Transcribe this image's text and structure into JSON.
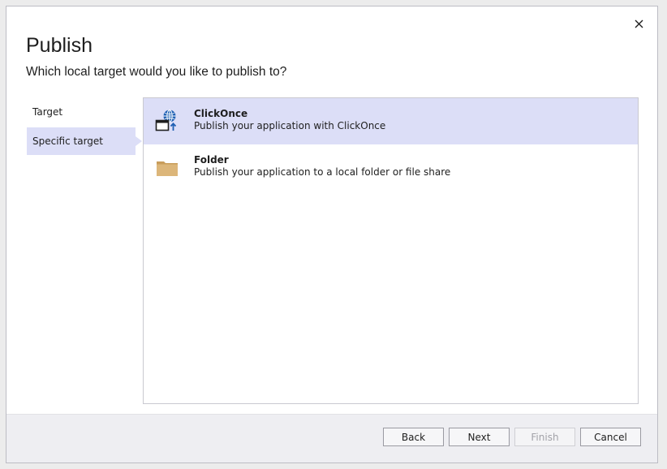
{
  "dialog": {
    "title": "Publish",
    "subtitle": "Which local target would you like to publish to?",
    "close_icon": "close-icon"
  },
  "nav": {
    "items": [
      {
        "label": "Target",
        "selected": false
      },
      {
        "label": "Specific target",
        "selected": true
      }
    ]
  },
  "targets": [
    {
      "name": "ClickOnce",
      "description": "Publish your application with ClickOnce",
      "icon": "clickonce-icon",
      "selected": true
    },
    {
      "name": "Folder",
      "description": "Publish your application to a local folder or file share",
      "icon": "folder-icon",
      "selected": false
    }
  ],
  "buttons": {
    "back": "Back",
    "next": "Next",
    "finish": "Finish",
    "cancel": "Cancel"
  },
  "colors": {
    "selection": "#dcdef7",
    "globe": "#1e5fb3",
    "folder": "#dcb67a"
  }
}
